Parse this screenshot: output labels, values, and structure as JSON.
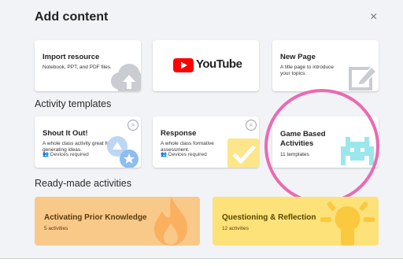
{
  "header": {
    "title": "Add content",
    "close_symbol": "×"
  },
  "sections": {
    "activity_templates": "Activity templates",
    "ready_made": "Ready-made activities"
  },
  "cards": {
    "import_resource": {
      "title": "Import resource",
      "desc": "Notebook, PPT, and PDF files."
    },
    "youtube": {
      "label": "YouTube"
    },
    "new_page": {
      "title": "New Page",
      "desc": "A title page to introduce your topics."
    },
    "shout_it_out": {
      "title": "Shout It Out!",
      "desc": "A whole class activity great for generating ideas.",
      "devices": "Devices required"
    },
    "response": {
      "title": "Response",
      "desc": "A whole class formative assessment.",
      "devices": "Devices required"
    },
    "game_based": {
      "title": "Game Based Activities",
      "count": "11 templates"
    }
  },
  "ready_made": {
    "activating": {
      "title": "Activating Prior Knowledge",
      "count": "5 activities"
    },
    "questioning": {
      "title": "Questioning & Reflection",
      "count": "12 activities"
    }
  },
  "colors": {
    "highlight_ring": "#e96bb0",
    "youtube_red": "#ff0000",
    "orange_card": "#f9c98a",
    "yellow_card": "#fde27a"
  },
  "icons": [
    "cloud-upload-icon",
    "youtube-play-icon",
    "pencil-icon",
    "magnifier-icon",
    "people-icon",
    "speech-bubbles-icon",
    "checkmark-icon",
    "pixel-invader-icon",
    "flame-icon",
    "lightbulb-icon"
  ]
}
